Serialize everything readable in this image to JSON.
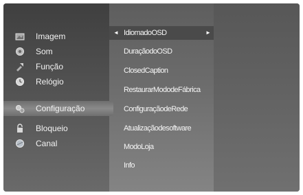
{
  "left_menu": {
    "items": [
      {
        "label": "Imagem",
        "icon": "picture-icon"
      },
      {
        "label": "Som",
        "icon": "sound-icon"
      },
      {
        "label": "Função",
        "icon": "function-icon"
      },
      {
        "label": "Relógio",
        "icon": "clock-icon"
      },
      {
        "label": "Configuração",
        "icon": "setup-icon"
      },
      {
        "label": "Bloqueio",
        "icon": "lock-icon"
      },
      {
        "label": "Canal",
        "icon": "channel-icon"
      }
    ],
    "selected": "Configuração"
  },
  "submenu": {
    "items": [
      {
        "label": "IdiomadoOSD"
      },
      {
        "label": "DuraçãodoOSD"
      },
      {
        "label": "ClosedCaption"
      },
      {
        "label": "RestaurarMododeFábrica"
      },
      {
        "label": "ConfiguraçãodeRede"
      },
      {
        "label": "Atualizaçãodesoftware"
      },
      {
        "label": "ModoLoja"
      },
      {
        "label": "Info"
      }
    ],
    "selected": "IdiomadoOSD",
    "arrow_left": "◄",
    "arrow_right": "►"
  },
  "colors": {
    "accent": "#4a4a4a",
    "text": "#f2f2f2"
  }
}
